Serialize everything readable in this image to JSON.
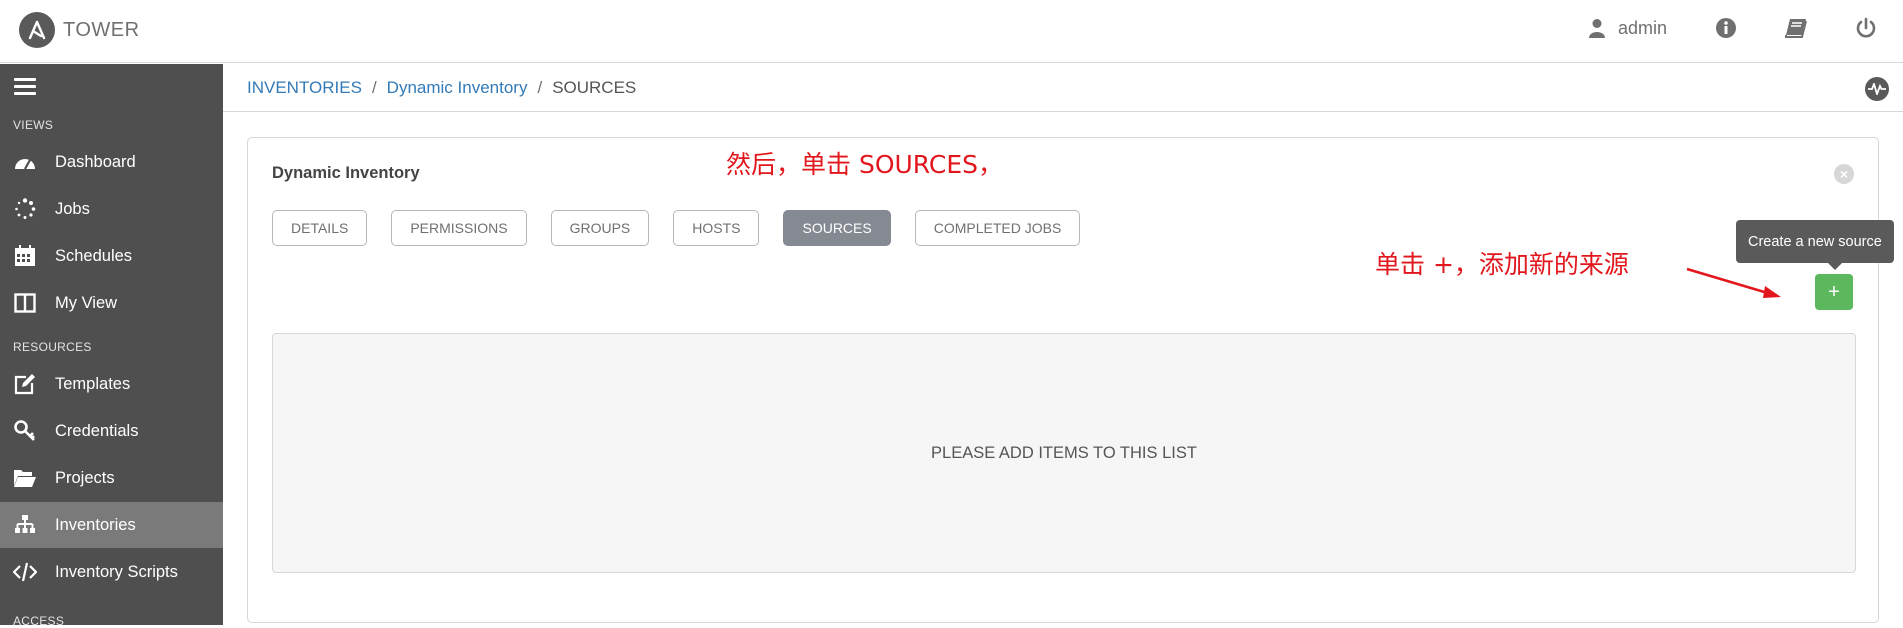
{
  "header": {
    "brand": "TOWER",
    "user": "admin"
  },
  "sidebar": {
    "sections": [
      "VIEWS",
      "RESOURCES",
      "ACCESS"
    ],
    "views": [
      {
        "label": "Dashboard",
        "icon": "dashboard-icon"
      },
      {
        "label": "Jobs",
        "icon": "spinner-icon"
      },
      {
        "label": "Schedules",
        "icon": "calendar-icon"
      },
      {
        "label": "My View",
        "icon": "columns-icon"
      }
    ],
    "resources": [
      {
        "label": "Templates",
        "icon": "edit-icon"
      },
      {
        "label": "Credentials",
        "icon": "key-icon"
      },
      {
        "label": "Projects",
        "icon": "folder-open-icon"
      },
      {
        "label": "Inventories",
        "icon": "sitemap-icon",
        "active": true
      },
      {
        "label": "Inventory Scripts",
        "icon": "code-icon"
      }
    ]
  },
  "breadcrumb": {
    "items": [
      "INVENTORIES",
      "Dynamic Inventory",
      "SOURCES"
    ],
    "separator": "/"
  },
  "panel": {
    "title": "Dynamic Inventory",
    "tabs": [
      "DETAILS",
      "PERMISSIONS",
      "GROUPS",
      "HOSTS",
      "SOURCES",
      "COMPLETED JOBS"
    ],
    "active_tab": "SOURCES",
    "add_label": "+",
    "tooltip": "Create a new source",
    "empty_message": "PLEASE ADD ITEMS TO THIS LIST"
  },
  "annotations": {
    "top": "然后，单击 SOURCES，",
    "right": "单击 +，添加新的来源"
  },
  "colors": {
    "sidebar_bg": "#4f4f4f",
    "active_item": "#7a7a7a",
    "link": "#337ab7",
    "add_button": "#5cb85c",
    "annotation": "#e2171d"
  }
}
